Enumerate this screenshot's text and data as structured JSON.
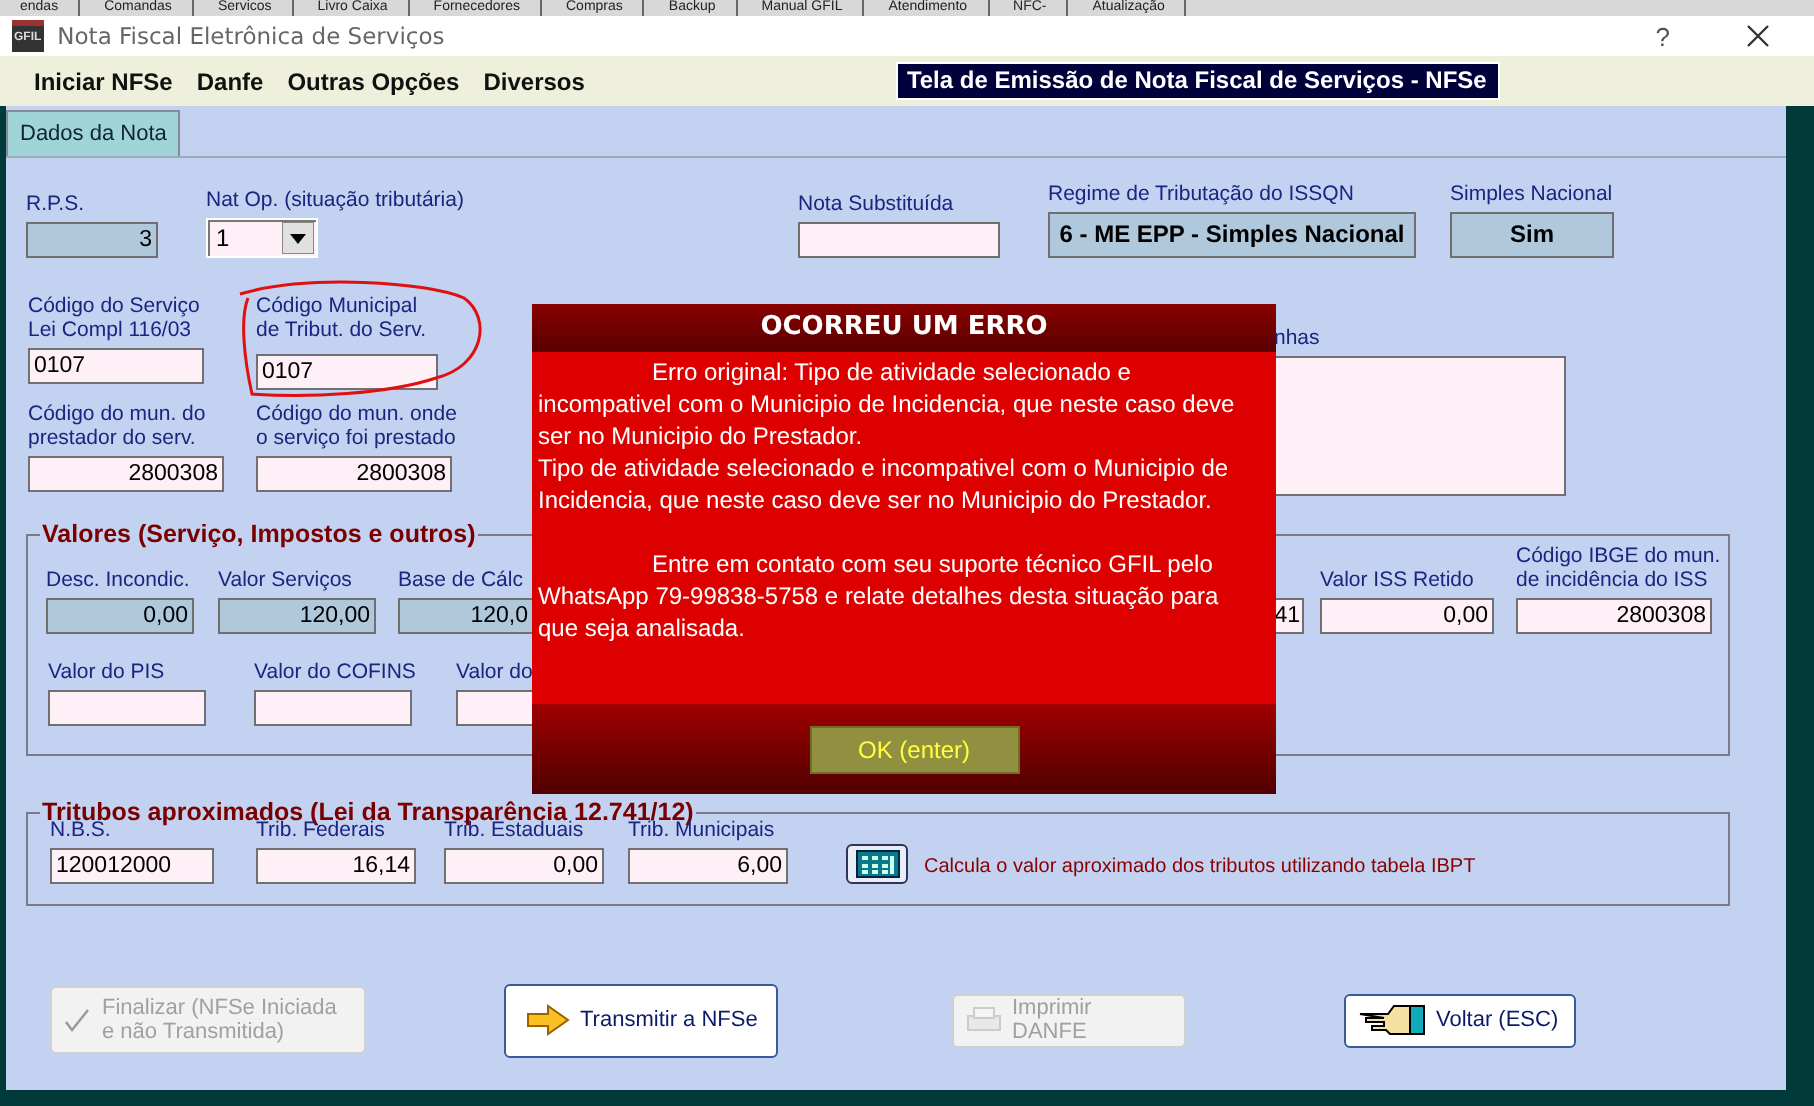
{
  "background_tabs": [
    "endas",
    "Comandas",
    "Servicos",
    "Livro Caixa",
    "Fornecedores",
    "Compras",
    "Backup",
    "Manual GFIL",
    "Atendimento",
    "NFC-",
    "Atualização"
  ],
  "window": {
    "logo": "GFIL",
    "title": "Nota Fiscal Eletrônica de Serviços",
    "help": "?"
  },
  "menu": [
    "Iniciar NFSe",
    "Danfe",
    "Outras Opções",
    "Diversos"
  ],
  "banner": "Tela de Emissão de Nota Fiscal de Serviços  - NFSe",
  "tabs": [
    {
      "label": "Dados da Nota",
      "selected": true
    }
  ],
  "rows": [
    [
      {
        "label": "R.P.S.",
        "value": "3",
        "kind": "readonly-number"
      },
      {
        "label": "Nat Op. (situação tributária)",
        "value": "1",
        "kind": "select"
      },
      {
        "label": "Nota Substituída",
        "kind": "text"
      },
      {
        "label": "Regime de Tributação do ISSQN",
        "value": "6 - ME EPP - Simples Nacional",
        "kind": "readonly-bold"
      },
      {
        "label": "Simples Nacional",
        "value": "Sim",
        "kind": "readonly-bold"
      }
    ],
    [
      {
        "label": "Código do Serviço\nLei Compl 116/03",
        "value": "0107",
        "kind": "text"
      },
      {
        "label": "Código Municipal\nde Tribut. do Serv.",
        "value": "0107",
        "kind": "text"
      },
      {
        "label": "nhas",
        "kind": "textarea"
      }
    ],
    [
      {
        "label": "Código do mun. do\nprestador do serv.",
        "value": "2800308",
        "kind": "number"
      },
      {
        "label": "Código do mun. onde\no serviço foi prestado",
        "value": "2800308",
        "kind": "number"
      }
    ]
  ],
  "valores": {
    "legend": "Valores (Serviço, Impostos e outros)",
    "rows": [
      [
        {
          "label": "Desc. Incondic.",
          "value": "0,00",
          "kind": "readonly-number"
        },
        {
          "label": "Valor Serviços",
          "value": "120,00",
          "kind": "readonly-number"
        },
        {
          "label": "Base de Cálc",
          "value": "120,0",
          "kind": "readonly-number"
        },
        {
          "value": "41",
          "kind": "number"
        },
        {
          "label": "Valor ISS Retido",
          "value": "0,00",
          "kind": "number"
        },
        {
          "label": "Código IBGE do mun.\nde incidência do ISS",
          "value": "2800308",
          "kind": "number"
        }
      ],
      [
        {
          "label": "Valor do PIS",
          "kind": "number"
        },
        {
          "label": "Valor do COFINS",
          "kind": "number"
        },
        {
          "label": "Valor do",
          "kind": "number"
        }
      ]
    ]
  },
  "tributos": {
    "legend": "Tritubos aproximados (Lei da Transparência 12.741/12)",
    "fields": [
      {
        "label": "N.B.S.",
        "value": "120012000",
        "kind": "text"
      },
      {
        "label": "Trib. Federais",
        "value": "16,14",
        "kind": "number"
      },
      {
        "label": "Trib. Estaduais",
        "value": "0,00",
        "kind": "number"
      },
      {
        "label": "Trib. Municipais",
        "value": "6,00",
        "kind": "number"
      }
    ],
    "calc_note": "Calcula o valor aproximado dos tributos utilizando tabela IBPT"
  },
  "buttons": [
    {
      "label": "Finalizar (NFSe Iniciada e não Transmitida)",
      "kind": "finalize",
      "disabled": true
    },
    {
      "label": "Transmitir a NFSe",
      "kind": "transmit",
      "disabled": false
    },
    {
      "label": "Imprimir DANFE",
      "kind": "print",
      "disabled": true
    },
    {
      "label": "Voltar (ESC)",
      "kind": "back",
      "disabled": false
    }
  ],
  "dialog": {
    "title": "OCORREU UM ERRO",
    "paragraphs": [
      {
        "text": "Erro original: Tipo de atividade selecionado e incompativel com o Municipio de Incidencia, que neste caso deve ser no Municipio do Prestador.",
        "indent": true
      },
      {
        "text": "Tipo de atividade selecionado e incompativel com o Municipio de Incidencia, que neste caso deve ser no Municipio do Prestador.",
        "indent": false
      },
      {
        "text": "Entre em contato com seu suporte técnico GFIL pelo WhatsApp 79-99838-5758 e relate detalhes desta situação para que seja analisada.",
        "indent": true
      }
    ],
    "button": "OK (enter)"
  }
}
